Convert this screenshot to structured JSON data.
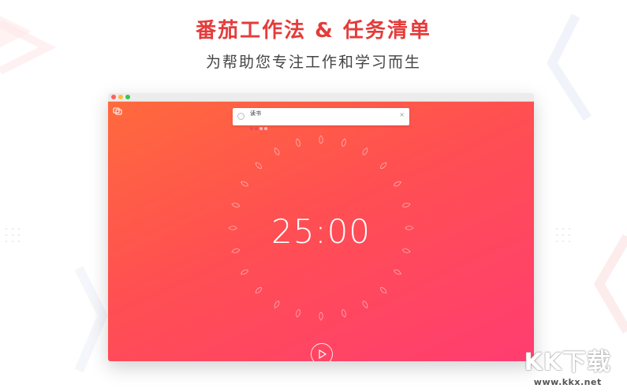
{
  "headline": "番茄工作法 & 任务清单",
  "subline": "为帮助您专注工作和学习而生",
  "window": {
    "task": {
      "name": "读书",
      "dot_colors": [
        "#e84a5f",
        "#e84a5f",
        "#f6b7c2",
        "#f6b7c2"
      ],
      "close_label": "×"
    },
    "timer": "25:00",
    "play_icon": "play-icon",
    "side_icon": "task-list-icon"
  },
  "watermark": {
    "main": "KK下载",
    "url": "www.kkx.net"
  },
  "colors": {
    "accent": "#e53b3b",
    "gradient_start": "#ff6a3d",
    "gradient_end": "#ff3d71"
  }
}
